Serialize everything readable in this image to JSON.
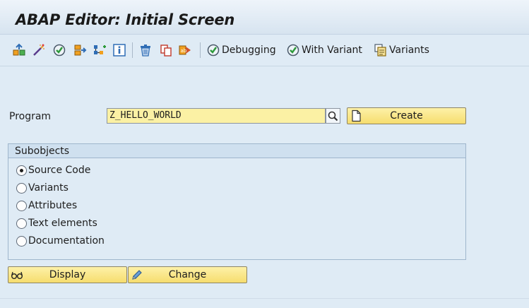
{
  "window": {
    "title": "ABAP Editor: Initial Screen"
  },
  "toolbar": {
    "icons": [
      "object-list-icon",
      "magic-wand-icon",
      "check-icon",
      "other-object-icon",
      "where-used-icon",
      "info-icon",
      "delete-icon",
      "copy-icon",
      "rename-icon"
    ],
    "debugging_label": "Debugging",
    "with_variant_label": "With Variant",
    "variants_label": "Variants"
  },
  "program": {
    "label": "Program",
    "value": "Z_HELLO_WORLD",
    "create_label": "Create"
  },
  "subobjects": {
    "title": "Subobjects",
    "options": [
      {
        "label": "Source Code",
        "selected": true
      },
      {
        "label": "Variants",
        "selected": false
      },
      {
        "label": "Attributes",
        "selected": false
      },
      {
        "label": "Text elements",
        "selected": false
      },
      {
        "label": "Documentation",
        "selected": false
      }
    ]
  },
  "actions": {
    "display_label": "Display",
    "change_label": "Change"
  },
  "colors": {
    "background": "#dfebf5",
    "input_required": "#fbf1a4",
    "button": "#f6dd6e"
  }
}
